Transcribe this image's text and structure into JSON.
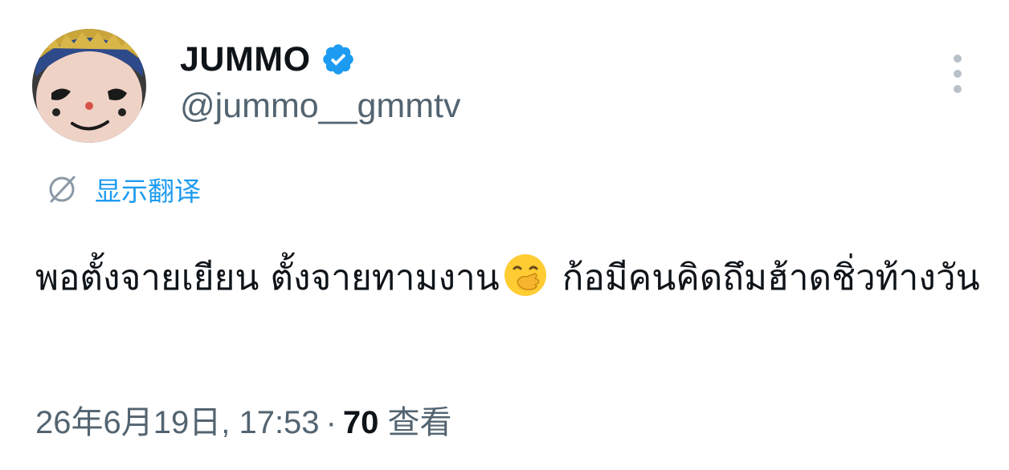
{
  "author": {
    "display_name": "JUMMO",
    "handle": "@jummo__gmmtv",
    "verified": true,
    "verified_color": "#1d9bf0"
  },
  "translate": {
    "label": "显示翻译",
    "icon": "globe-translate-icon",
    "color": "#1d9bf0"
  },
  "tweet": {
    "text_before_emoji": "พอตั้งจายเยียน ตั้งจายทามงาน",
    "emoji": "face-with-hand-over-mouth",
    "text_after_emoji": " ก้อมีคนคิดถึมฮ้าดชิ่วท้างวัน"
  },
  "meta": {
    "timestamp": "26年6月19日, 17:53",
    "separator": "·",
    "views_count": "70",
    "views_label": "查看"
  },
  "colors": {
    "text_primary": "#0f1419",
    "text_secondary": "#536471",
    "accent": "#1d9bf0"
  }
}
